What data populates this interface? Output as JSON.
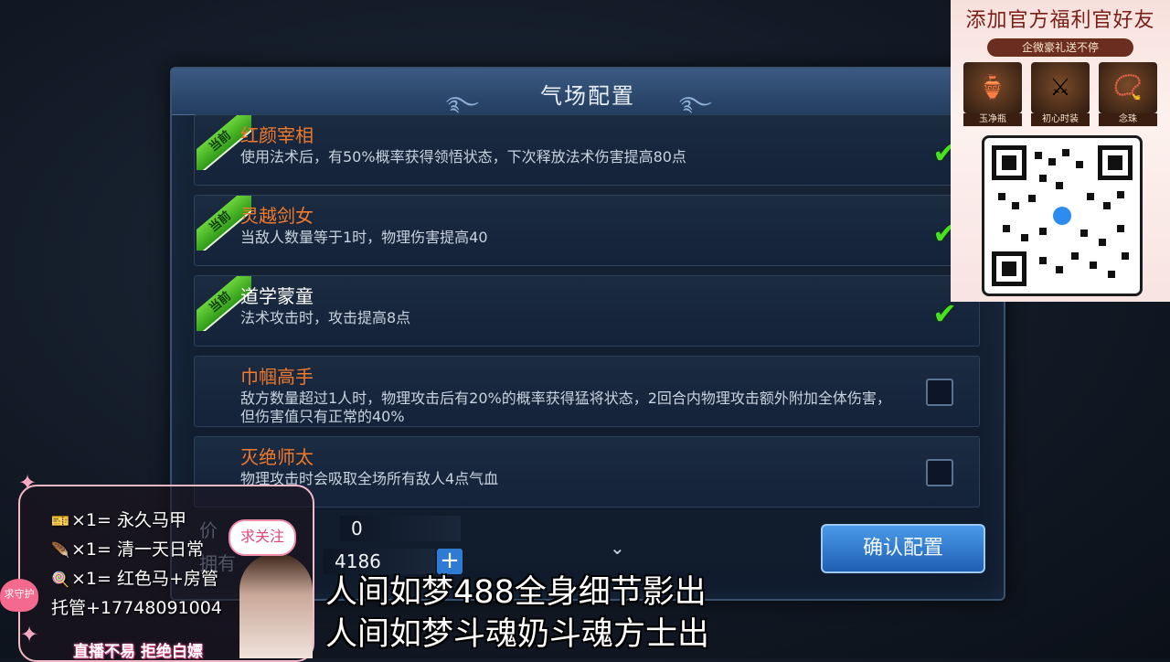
{
  "dialog": {
    "title": "气场配置",
    "items": [
      {
        "badge": "当前",
        "name": "红颜宰相",
        "desc": "使用法术后，有50%概率获得领悟状态，下次释放法术伤害提高80点",
        "checked": true,
        "name_color": "#f07a2a"
      },
      {
        "badge": "当前",
        "name": "灵越剑女",
        "desc": "当敌人数量等于1时，物理伤害提高40",
        "checked": true,
        "name_color": "#f07a2a"
      },
      {
        "badge": "当前",
        "name": "道学蒙童",
        "desc": "法术攻击时，攻击提高8点",
        "checked": true,
        "name_color": "#ffffff"
      },
      {
        "badge": "",
        "name": "巾帼高手",
        "desc": "敌方数量超过1人时，物理攻击后有20%的概率获得猛将状态，2回合内物理攻击额外附加全体伤害，但伤害值只有正常的40%",
        "checked": false,
        "name_color": "#f07a2a"
      },
      {
        "badge": "",
        "name": "灭绝师太",
        "desc": "物理攻击时会吸取全场所有敌人4点气血",
        "checked": false,
        "name_color": "#f07a2a"
      }
    ],
    "price_label": "价",
    "price_value": "0",
    "owned_label": "拥有",
    "owned_value": "4186",
    "add_icon": "plus-icon",
    "confirm_label": "确认配置"
  },
  "ad": {
    "title": "添加官方福利官好友",
    "subtitle": "企微豪礼送不停",
    "gifts": [
      {
        "label": "玉净瓶",
        "icon": "vase-icon"
      },
      {
        "label": "初心时装",
        "icon": "costume-icon"
      },
      {
        "label": "念珠",
        "icon": "beads-icon"
      }
    ]
  },
  "overlay": {
    "perks": [
      {
        "icon": "ticket-icon",
        "text": "×1= 永久马甲"
      },
      {
        "icon": "feather-icon",
        "text": "×1= 清一天日常"
      },
      {
        "icon": "lollipop-icon",
        "text": "×1= 红色马+房管"
      },
      {
        "icon": "",
        "text": "托管+17748091004"
      }
    ],
    "follow": "求关注",
    "heart_text": "求守护",
    "bottom_tag": "直播不易  拒绝白嫖"
  },
  "captions": [
    "人间如梦488全身细节影出",
    "人间如梦斗魂奶斗魂方士出"
  ],
  "colors": {
    "check": "#46e21d",
    "accent": "#2f7bd4"
  }
}
